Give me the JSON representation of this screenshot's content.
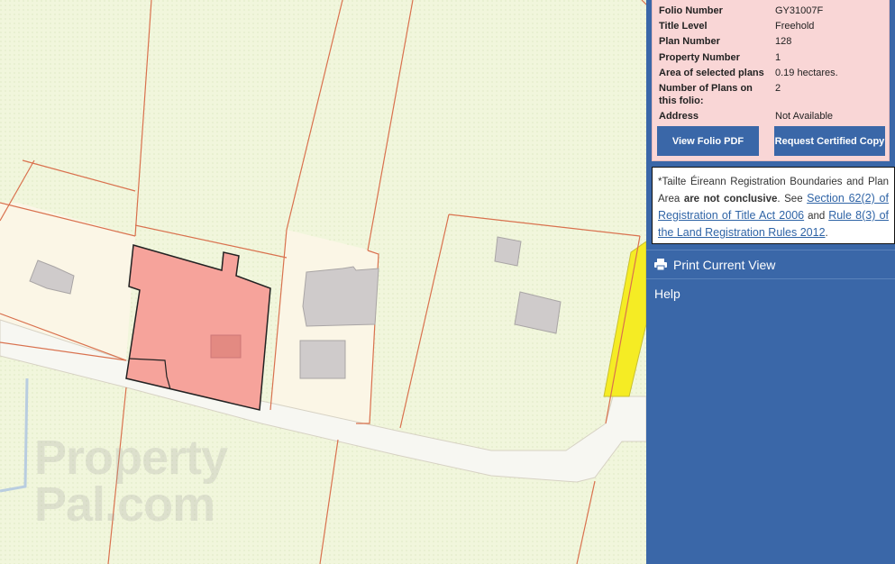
{
  "map": {
    "watermark_line1": "Property",
    "watermark_line2": "Pal.com",
    "colors": {
      "background": "#f1f6dc",
      "boundary": "#d9714e",
      "selected_fill": "#f6a39b",
      "selected_stroke": "#222222",
      "road": "#f7f7f2",
      "building": "#cfcbcb",
      "highlight_road": "#f5ec24"
    }
  },
  "folio": {
    "fields": [
      {
        "label": "Folio Number",
        "value": "GY31007F"
      },
      {
        "label": "Title Level",
        "value": "Freehold"
      },
      {
        "label": "Plan Number",
        "value": "128"
      },
      {
        "label": "Property Number",
        "value": "1"
      },
      {
        "label": "Area of selected plans",
        "value": "0.19 hectares."
      },
      {
        "label": "Number of Plans on this folio:",
        "value": "2"
      },
      {
        "label": "Address",
        "value": "Not Available"
      }
    ],
    "view_pdf_label": "View Folio PDF",
    "request_cert_label": "Request Certified Copy"
  },
  "disclaimer": {
    "prefix": "*Tailte Éireann Registration Boundaries and Plan Area ",
    "bold": "are not conclusive",
    "mid1": ". See ",
    "link1": "Section 62(2) of Registration of Title Act 2006",
    "mid2": " and ",
    "link2": "Rule 8(3) of the Land Registration Rules 2012",
    "suffix": "."
  },
  "menu": {
    "print_label": "Print Current View",
    "print_icon": "printer-icon",
    "help_label": "Help"
  }
}
